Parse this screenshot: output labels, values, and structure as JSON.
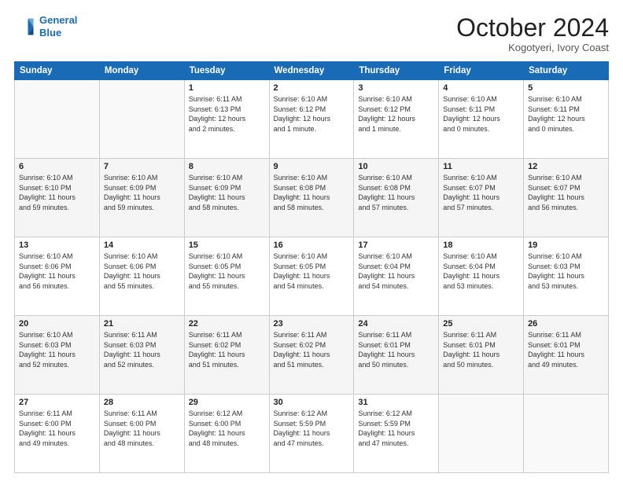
{
  "header": {
    "logo_line1": "General",
    "logo_line2": "Blue",
    "month": "October 2024",
    "location": "Kogotyeri, Ivory Coast"
  },
  "weekdays": [
    "Sunday",
    "Monday",
    "Tuesday",
    "Wednesday",
    "Thursday",
    "Friday",
    "Saturday"
  ],
  "weeks": [
    [
      {
        "day": "",
        "text": ""
      },
      {
        "day": "",
        "text": ""
      },
      {
        "day": "1",
        "text": "Sunrise: 6:11 AM\nSunset: 6:13 PM\nDaylight: 12 hours\nand 2 minutes."
      },
      {
        "day": "2",
        "text": "Sunrise: 6:10 AM\nSunset: 6:12 PM\nDaylight: 12 hours\nand 1 minute."
      },
      {
        "day": "3",
        "text": "Sunrise: 6:10 AM\nSunset: 6:12 PM\nDaylight: 12 hours\nand 1 minute."
      },
      {
        "day": "4",
        "text": "Sunrise: 6:10 AM\nSunset: 6:11 PM\nDaylight: 12 hours\nand 0 minutes."
      },
      {
        "day": "5",
        "text": "Sunrise: 6:10 AM\nSunset: 6:11 PM\nDaylight: 12 hours\nand 0 minutes."
      }
    ],
    [
      {
        "day": "6",
        "text": "Sunrise: 6:10 AM\nSunset: 6:10 PM\nDaylight: 11 hours\nand 59 minutes."
      },
      {
        "day": "7",
        "text": "Sunrise: 6:10 AM\nSunset: 6:09 PM\nDaylight: 11 hours\nand 59 minutes."
      },
      {
        "day": "8",
        "text": "Sunrise: 6:10 AM\nSunset: 6:09 PM\nDaylight: 11 hours\nand 58 minutes."
      },
      {
        "day": "9",
        "text": "Sunrise: 6:10 AM\nSunset: 6:08 PM\nDaylight: 11 hours\nand 58 minutes."
      },
      {
        "day": "10",
        "text": "Sunrise: 6:10 AM\nSunset: 6:08 PM\nDaylight: 11 hours\nand 57 minutes."
      },
      {
        "day": "11",
        "text": "Sunrise: 6:10 AM\nSunset: 6:07 PM\nDaylight: 11 hours\nand 57 minutes."
      },
      {
        "day": "12",
        "text": "Sunrise: 6:10 AM\nSunset: 6:07 PM\nDaylight: 11 hours\nand 56 minutes."
      }
    ],
    [
      {
        "day": "13",
        "text": "Sunrise: 6:10 AM\nSunset: 6:06 PM\nDaylight: 11 hours\nand 56 minutes."
      },
      {
        "day": "14",
        "text": "Sunrise: 6:10 AM\nSunset: 6:06 PM\nDaylight: 11 hours\nand 55 minutes."
      },
      {
        "day": "15",
        "text": "Sunrise: 6:10 AM\nSunset: 6:05 PM\nDaylight: 11 hours\nand 55 minutes."
      },
      {
        "day": "16",
        "text": "Sunrise: 6:10 AM\nSunset: 6:05 PM\nDaylight: 11 hours\nand 54 minutes."
      },
      {
        "day": "17",
        "text": "Sunrise: 6:10 AM\nSunset: 6:04 PM\nDaylight: 11 hours\nand 54 minutes."
      },
      {
        "day": "18",
        "text": "Sunrise: 6:10 AM\nSunset: 6:04 PM\nDaylight: 11 hours\nand 53 minutes."
      },
      {
        "day": "19",
        "text": "Sunrise: 6:10 AM\nSunset: 6:03 PM\nDaylight: 11 hours\nand 53 minutes."
      }
    ],
    [
      {
        "day": "20",
        "text": "Sunrise: 6:10 AM\nSunset: 6:03 PM\nDaylight: 11 hours\nand 52 minutes."
      },
      {
        "day": "21",
        "text": "Sunrise: 6:11 AM\nSunset: 6:03 PM\nDaylight: 11 hours\nand 52 minutes."
      },
      {
        "day": "22",
        "text": "Sunrise: 6:11 AM\nSunset: 6:02 PM\nDaylight: 11 hours\nand 51 minutes."
      },
      {
        "day": "23",
        "text": "Sunrise: 6:11 AM\nSunset: 6:02 PM\nDaylight: 11 hours\nand 51 minutes."
      },
      {
        "day": "24",
        "text": "Sunrise: 6:11 AM\nSunset: 6:01 PM\nDaylight: 11 hours\nand 50 minutes."
      },
      {
        "day": "25",
        "text": "Sunrise: 6:11 AM\nSunset: 6:01 PM\nDaylight: 11 hours\nand 50 minutes."
      },
      {
        "day": "26",
        "text": "Sunrise: 6:11 AM\nSunset: 6:01 PM\nDaylight: 11 hours\nand 49 minutes."
      }
    ],
    [
      {
        "day": "27",
        "text": "Sunrise: 6:11 AM\nSunset: 6:00 PM\nDaylight: 11 hours\nand 49 minutes."
      },
      {
        "day": "28",
        "text": "Sunrise: 6:11 AM\nSunset: 6:00 PM\nDaylight: 11 hours\nand 48 minutes."
      },
      {
        "day": "29",
        "text": "Sunrise: 6:12 AM\nSunset: 6:00 PM\nDaylight: 11 hours\nand 48 minutes."
      },
      {
        "day": "30",
        "text": "Sunrise: 6:12 AM\nSunset: 5:59 PM\nDaylight: 11 hours\nand 47 minutes."
      },
      {
        "day": "31",
        "text": "Sunrise: 6:12 AM\nSunset: 5:59 PM\nDaylight: 11 hours\nand 47 minutes."
      },
      {
        "day": "",
        "text": ""
      },
      {
        "day": "",
        "text": ""
      }
    ]
  ]
}
